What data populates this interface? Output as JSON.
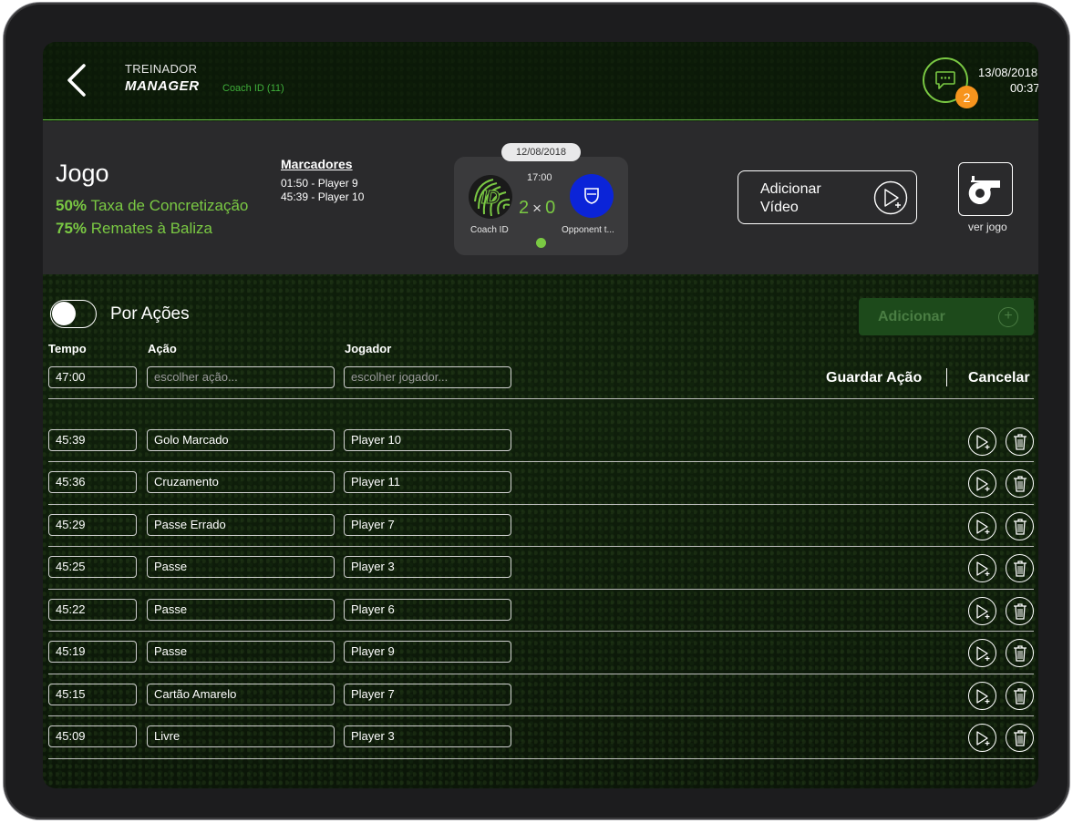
{
  "header": {
    "brand_top": "TREINADOR",
    "brand_bottom": "MANAGER",
    "coach_id": "Coach ID  (11)",
    "chat_badge": "2",
    "date": "13/08/2018",
    "time": "00:37"
  },
  "summary": {
    "title": "Jogo",
    "stats": [
      {
        "value": "50%",
        "label": "Taxa de Concretização"
      },
      {
        "value": "75%",
        "label": "Remates à Baliza"
      }
    ],
    "scorers_title": "Marcadores",
    "scorers": [
      "01:50 - Player 9",
      "45:39 - Player 10"
    ],
    "match": {
      "date": "12/08/2018",
      "time": "17:00",
      "home_score": "2",
      "separator": "×",
      "away_score": "0",
      "home_name": "Coach ID",
      "away_name": "Opponent t..."
    },
    "add_video_label": "Adicionar Vídeo",
    "ver_jogo_label": "ver jogo"
  },
  "controls": {
    "toggle_label": "Por Ações",
    "add_label": "Adicionar",
    "col_tempo": "Tempo",
    "col_acao": "Ação",
    "col_jogador": "Jogador",
    "new_time": "47:00",
    "acao_placeholder": "escolher ação...",
    "jogador_placeholder": "escolher jogador...",
    "save_label": "Guardar Ação",
    "cancel_label": "Cancelar"
  },
  "actions": [
    {
      "time": "45:39",
      "action": "Golo Marcado",
      "player": "Player 10"
    },
    {
      "time": "45:36",
      "action": "Cruzamento",
      "player": "Player 11"
    },
    {
      "time": "45:29",
      "action": "Passe Errado",
      "player": "Player 7"
    },
    {
      "time": "45:25",
      "action": "Passe",
      "player": "Player 3"
    },
    {
      "time": "45:22",
      "action": "Passe",
      "player": "Player 6"
    },
    {
      "time": "45:19",
      "action": "Passe",
      "player": "Player 9"
    },
    {
      "time": "45:15",
      "action": "Cartão Amarelo",
      "player": "Player 7"
    },
    {
      "time": "45:09",
      "action": "Livre",
      "player": "Player 3"
    }
  ],
  "colors": {
    "accent_green": "#7ac943",
    "badge_orange": "#f7941d",
    "away_blue": "#0b24d8"
  }
}
